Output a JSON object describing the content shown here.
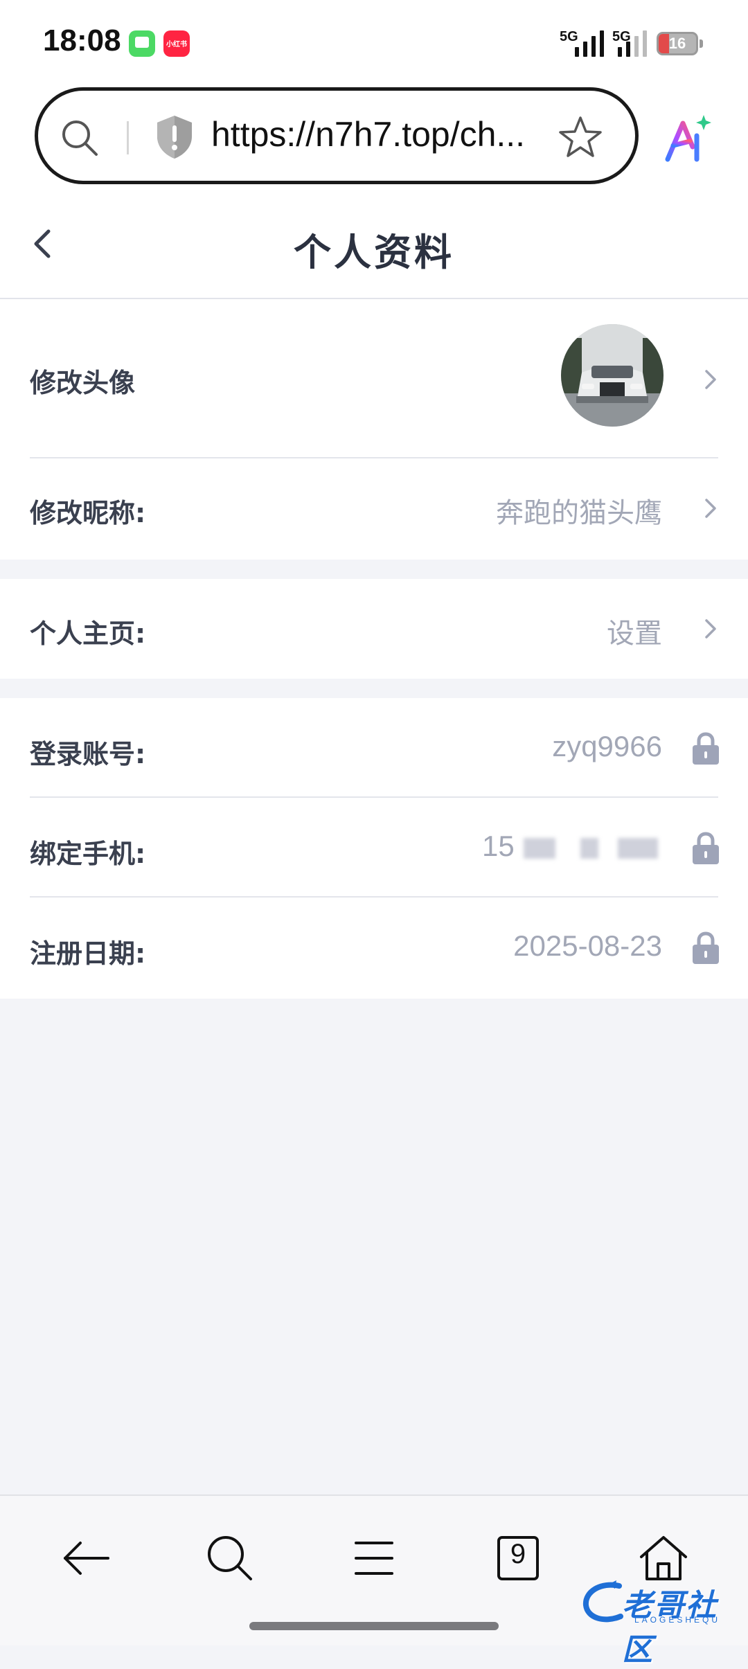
{
  "status_bar": {
    "time": "18:08",
    "network_1": "5G",
    "network_2": "5G",
    "battery_level": "16",
    "icons": [
      "messages-app-icon",
      "xiaohongshu-app-icon",
      "signal-icon",
      "battery-icon"
    ]
  },
  "browser": {
    "url": "https://n7h7.top/ch...",
    "icons": [
      "search-icon",
      "shield-warning-icon",
      "star-icon",
      "ai-assistant-icon"
    ]
  },
  "header": {
    "title": "个人资料",
    "back_icon": "chevron-left-icon"
  },
  "profile": {
    "avatar_label": "修改头像",
    "nickname_label": "修改昵称:",
    "nickname_value": "奔跑的猫头鹰",
    "homepage_label": "个人主页:",
    "homepage_value": "设置",
    "account_label": "登录账号:",
    "account_value": "zyq9966",
    "phone_label": "绑定手机:",
    "phone_value": "15",
    "register_label": "注册日期:",
    "register_value": "2025-08-23"
  },
  "bottom_bar": {
    "tabs_count": "9",
    "icons": [
      "back-arrow-icon",
      "search-icon",
      "menu-icon",
      "tabs-icon",
      "home-icon"
    ]
  },
  "watermark": {
    "text": "老哥社区",
    "sub": "LAOGESHEQU"
  },
  "colors": {
    "page_bg": "#f3f4f8",
    "label": "#3a404f",
    "value": "#a2a7b6",
    "lock": "#9ea4b8",
    "watermark": "#1f6fd6"
  }
}
